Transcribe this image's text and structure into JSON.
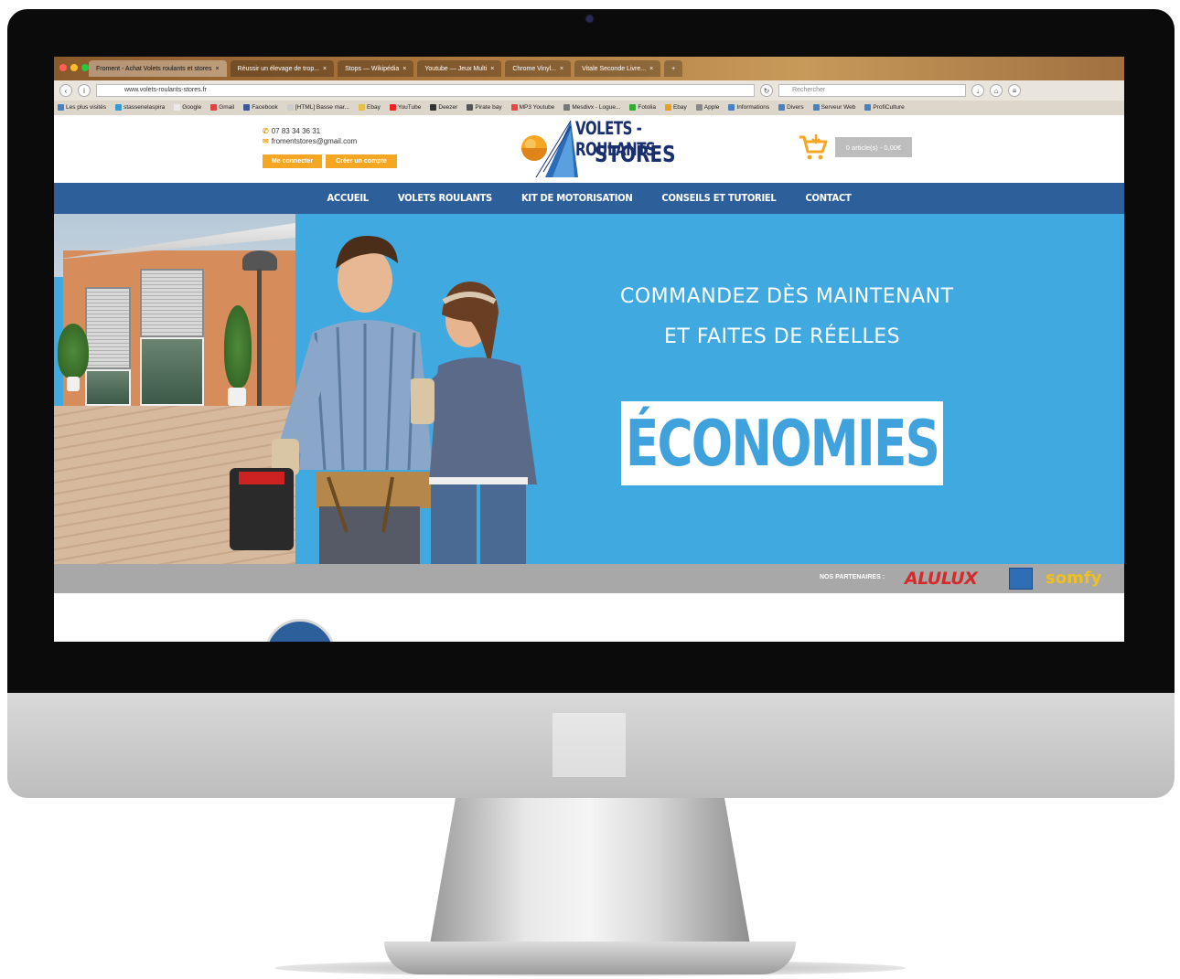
{
  "browser": {
    "tabs": [
      {
        "label": "Froment - Achat Volets roulants et stores",
        "active": true
      },
      {
        "label": "Réussir un élevage de trop...",
        "active": false
      },
      {
        "label": "Stops — Wikipédia",
        "active": false
      },
      {
        "label": "Youtube — Jeux Multi",
        "active": false
      },
      {
        "label": "Chrome Vinyl...",
        "active": false
      },
      {
        "label": "Vitale Seconde Livre...",
        "active": false
      }
    ],
    "url": "www.volets-roulants-stores.fr",
    "search_placeholder": "Rechercher",
    "bookmarks": [
      "Les plus visités",
      "stassenelaspira",
      "Google",
      "Gmail",
      "Facebook",
      "[HTML] Basse mar...",
      "Ebay",
      "YouTube",
      "Deezer",
      "Pirate bay",
      "MP3 Youtube",
      "Mesdivx - Logue...",
      "Fotolia",
      "Ebay",
      "Apple",
      "Informations",
      "Divers",
      "Serveur Web",
      "ProfiCulture"
    ]
  },
  "header": {
    "phone": "07 83 34 36 31",
    "email": "fromentstores@gmail.com",
    "login_label": "Me connecter",
    "create_label": "Créer un compte",
    "logo_line1": "VOLETS - ROULANTS",
    "logo_line2": "STORES",
    "cart_label": "0 article(s) - 0,00€"
  },
  "nav": {
    "items": [
      "ACCUEIL",
      "VOLETS ROULANTS",
      "KIT DE MOTORISATION",
      "CONSEILS ET TUTORIEL",
      "CONTACT"
    ]
  },
  "hero": {
    "line1": "COMMANDEZ DÈS MAINTENANT",
    "line2": "ET  FAITES DE RÉELLES",
    "highlight": "ÉCONOMIES"
  },
  "partners": {
    "label": "NOS PARTENAIRES :",
    "brand1": "ALULUX",
    "brand2": "somfy"
  },
  "colors": {
    "nav_blue": "#2d5f9a",
    "hero_blue": "#3fa9e0",
    "accent_orange": "#f5a623",
    "partners_gray": "#a8a8a8"
  }
}
